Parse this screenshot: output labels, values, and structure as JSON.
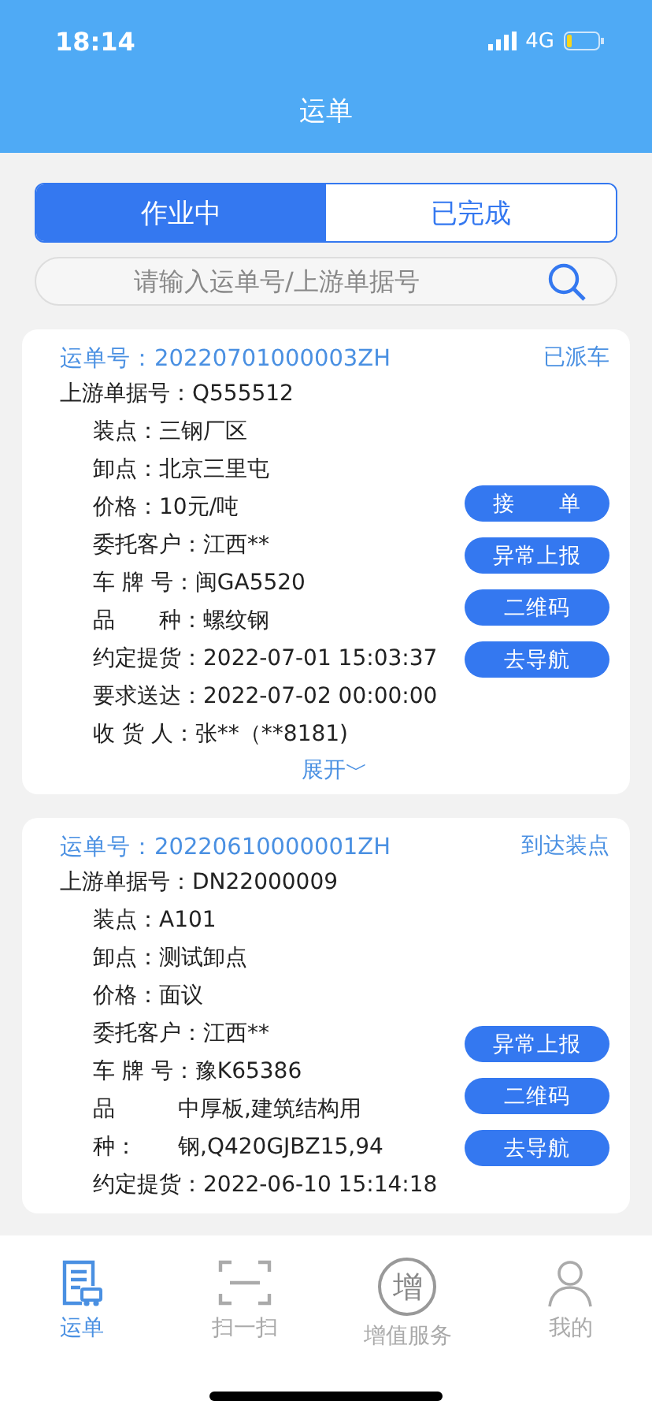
{
  "status_bar": {
    "time": "18:14",
    "network": "4G"
  },
  "header": {
    "title": "运单"
  },
  "tabs": [
    {
      "label": "作业中",
      "selected": true
    },
    {
      "label": "已完成",
      "selected": false
    }
  ],
  "search": {
    "placeholder": "请输入运单号/上游单据号"
  },
  "orders": [
    {
      "number_label": "运单号：",
      "number": "20220701000003ZH",
      "status": "已派车",
      "upstream_label": "上游单据号：",
      "upstream": "Q555512",
      "fields": [
        {
          "kind": "inline",
          "label": "装点：",
          "value": "三钢厂区"
        },
        {
          "kind": "inline",
          "label": "卸点：",
          "value": "北京三里屯"
        },
        {
          "kind": "inline",
          "label": "价格：",
          "value": "10元/吨"
        },
        {
          "kind": "inline",
          "label": "委托客户：",
          "value": "江西**"
        },
        {
          "kind": "inline",
          "label": "车 牌 号：",
          "value": "闽GA5520"
        },
        {
          "kind": "inline",
          "label": "品　　种：",
          "value": "螺纹钢"
        },
        {
          "kind": "inline",
          "label": "约定提货：",
          "value": "2022-07-01 15:03:37"
        },
        {
          "kind": "inline",
          "label": "要求送达：",
          "value": "2022-07-02 00:00:00"
        },
        {
          "kind": "inline",
          "label": "收 货 人：",
          "value": "张**（**8181)"
        }
      ],
      "buttons": [
        "接　　单",
        "异常上报",
        "二维码",
        "去导航"
      ],
      "expand": "展开﹀"
    },
    {
      "number_label": "运单号：",
      "number": "20220610000001ZH",
      "status": "到达装点",
      "upstream_label": "上游单据号：",
      "upstream": "DN22000009",
      "fields": [
        {
          "kind": "inline",
          "label": "装点：",
          "value": "A101"
        },
        {
          "kind": "inline",
          "label": "卸点：",
          "value": "测试卸点"
        },
        {
          "kind": "inline",
          "label": "价格：",
          "value": "面议"
        },
        {
          "kind": "inline",
          "label": "委托客户：",
          "value": "江西**"
        },
        {
          "kind": "inline",
          "label": "车 牌 号：",
          "value": "豫K65386"
        },
        {
          "kind": "column",
          "label": "品",
          "value": "中厚板,建筑结构用"
        },
        {
          "kind": "column",
          "label": "种：",
          "value": "钢,Q420GJBZ15,94"
        },
        {
          "kind": "inline",
          "label": "约定提货：",
          "value": "2022-06-10 15:14:18"
        }
      ],
      "buttons": [
        "异常上报",
        "二维码",
        "去导航"
      ]
    }
  ],
  "nav": [
    {
      "kind": "waybill",
      "label": "运单",
      "selected": true
    },
    {
      "kind": "scan",
      "label": "扫一扫",
      "selected": false
    },
    {
      "kind": "service",
      "label": "增值服务",
      "glyph": "增",
      "selected": false
    },
    {
      "kind": "profile",
      "label": "我的",
      "selected": false
    }
  ]
}
